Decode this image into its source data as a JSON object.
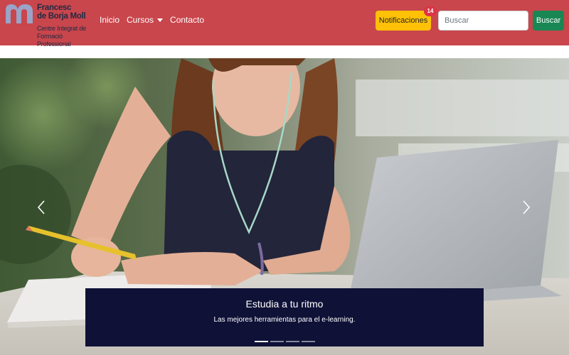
{
  "brand": {
    "name_line1": "Francesc",
    "name_line2": "de Borja Moll",
    "sub_line1": "Centre Integrat de",
    "sub_line2": "Formació Professional",
    "logo_color": "#9aa3c8",
    "text_color": "#222a44"
  },
  "nav": {
    "items": [
      {
        "label": "Inicio"
      },
      {
        "label": "Cursos"
      },
      {
        "label": "Contacto"
      }
    ]
  },
  "notifications": {
    "label": "Notificaciones",
    "count": "14",
    "color": "#ffc107",
    "badge_color": "#dc3545"
  },
  "search": {
    "placeholder": "Buscar",
    "button_label": "Buscar",
    "button_color": "#198754"
  },
  "carousel": {
    "caption_title": "Estudia a tu ritmo",
    "caption_text": "Las mejores herramientas para el e-learning.",
    "active_slide": 1,
    "slide_count": 4,
    "prev_icon": "chevron-left-icon",
    "next_icon": "chevron-right-icon",
    "caption_bg": "#0f1137"
  },
  "colors": {
    "navbar_bg": "#c8464c"
  }
}
